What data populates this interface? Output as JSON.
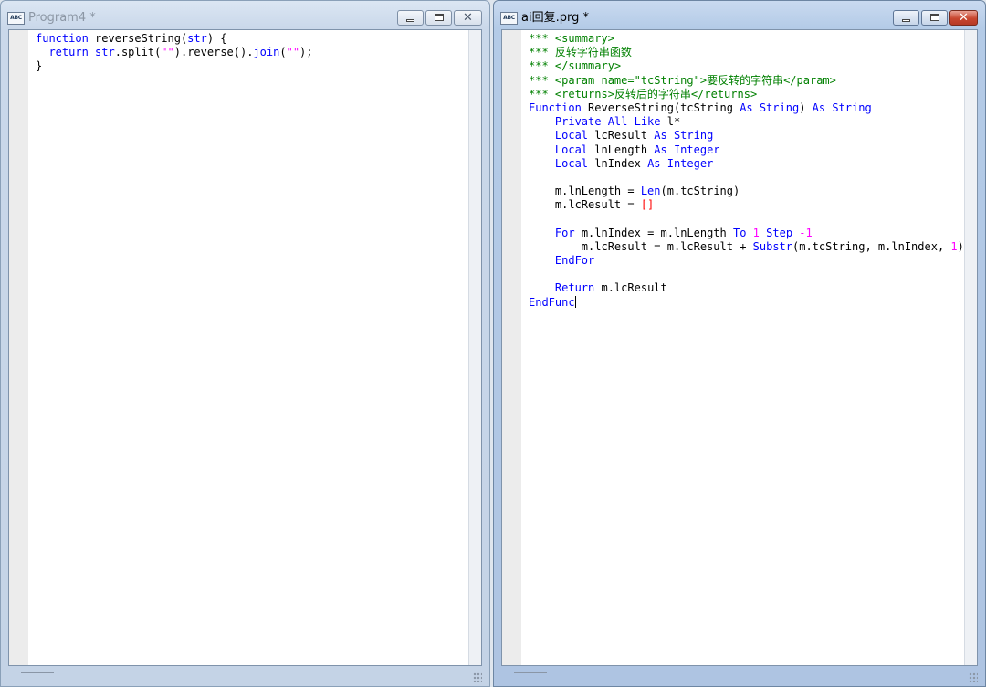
{
  "windows": {
    "left": {
      "title": "Program4 *",
      "icon_label": "ABC",
      "lines": [
        [
          {
            "t": "function",
            "c": "kw"
          },
          {
            "t": " reverseString(",
            "c": "pl"
          },
          {
            "t": "str",
            "c": "kw"
          },
          {
            "t": ") {",
            "c": "pl"
          }
        ],
        [
          {
            "t": "  return ",
            "c": "kw"
          },
          {
            "t": "str",
            "c": "kw"
          },
          {
            "t": ".split(",
            "c": "pl"
          },
          {
            "t": "\"\"",
            "c": "nm"
          },
          {
            "t": ").reverse().",
            "c": "pl"
          },
          {
            "t": "join",
            "c": "kw"
          },
          {
            "t": "(",
            "c": "pl"
          },
          {
            "t": "\"\"",
            "c": "nm"
          },
          {
            "t": ");",
            "c": "pl"
          }
        ],
        [
          {
            "t": "}",
            "c": "pl"
          }
        ]
      ]
    },
    "right": {
      "title": "ai回复.prg *",
      "icon_label": "ABC",
      "lines": [
        [
          {
            "t": "*** <summary>",
            "c": "cm"
          }
        ],
        [
          {
            "t": "*** 反转字符串函数",
            "c": "cm"
          }
        ],
        [
          {
            "t": "*** </summary>",
            "c": "cm"
          }
        ],
        [
          {
            "t": "*** <param name=\"tcString\">要反转的字符串</param>",
            "c": "cm"
          }
        ],
        [
          {
            "t": "*** <returns>反转后的字符串</returns>",
            "c": "cm"
          }
        ],
        [
          {
            "t": "Function",
            "c": "kw"
          },
          {
            "t": " ReverseString(tcString ",
            "c": "pl"
          },
          {
            "t": "As String",
            "c": "kw"
          },
          {
            "t": ") ",
            "c": "pl"
          },
          {
            "t": "As String",
            "c": "kw"
          }
        ],
        [
          {
            "t": "    ",
            "c": "pl"
          },
          {
            "t": "Private All Like",
            "c": "kw"
          },
          {
            "t": " l*",
            "c": "pl"
          }
        ],
        [
          {
            "t": "    ",
            "c": "pl"
          },
          {
            "t": "Local",
            "c": "kw"
          },
          {
            "t": " lcResult ",
            "c": "pl"
          },
          {
            "t": "As String",
            "c": "kw"
          }
        ],
        [
          {
            "t": "    ",
            "c": "pl"
          },
          {
            "t": "Local",
            "c": "kw"
          },
          {
            "t": " lnLength ",
            "c": "pl"
          },
          {
            "t": "As Integer",
            "c": "kw"
          }
        ],
        [
          {
            "t": "    ",
            "c": "pl"
          },
          {
            "t": "Local",
            "c": "kw"
          },
          {
            "t": " lnIndex ",
            "c": "pl"
          },
          {
            "t": "As Integer",
            "c": "kw"
          }
        ],
        [],
        [
          {
            "t": "    m.lnLength = ",
            "c": "pl"
          },
          {
            "t": "Len",
            "c": "kw"
          },
          {
            "t": "(m.tcString)",
            "c": "pl"
          }
        ],
        [
          {
            "t": "    m.lcResult = ",
            "c": "pl"
          },
          {
            "t": "[]",
            "c": "br"
          }
        ],
        [],
        [
          {
            "t": "    ",
            "c": "pl"
          },
          {
            "t": "For",
            "c": "kw"
          },
          {
            "t": " m.lnIndex = m.lnLength ",
            "c": "pl"
          },
          {
            "t": "To",
            "c": "kw"
          },
          {
            "t": " ",
            "c": "pl"
          },
          {
            "t": "1",
            "c": "nm"
          },
          {
            "t": " ",
            "c": "pl"
          },
          {
            "t": "Step",
            "c": "kw"
          },
          {
            "t": " ",
            "c": "pl"
          },
          {
            "t": "-1",
            "c": "nm"
          }
        ],
        [
          {
            "t": "        m.lcResult = m.lcResult + ",
            "c": "pl"
          },
          {
            "t": "Substr",
            "c": "kw"
          },
          {
            "t": "(m.tcString, m.lnIndex, ",
            "c": "pl"
          },
          {
            "t": "1",
            "c": "nm"
          },
          {
            "t": ")",
            "c": "pl"
          }
        ],
        [
          {
            "t": "    ",
            "c": "pl"
          },
          {
            "t": "EndFor",
            "c": "kw"
          }
        ],
        [],
        [
          {
            "t": "    ",
            "c": "pl"
          },
          {
            "t": "Return",
            "c": "kw"
          },
          {
            "t": " m.lcResult",
            "c": "pl"
          }
        ],
        [
          {
            "t": "EndFunc",
            "c": "kw"
          }
        ]
      ]
    }
  },
  "controls": {
    "close_glyph": "✕"
  },
  "colors": {
    "keyword": "#0000ff",
    "comment": "#008000",
    "number": "#ff00ff",
    "bracket": "#ff0000",
    "text": "#000000"
  }
}
